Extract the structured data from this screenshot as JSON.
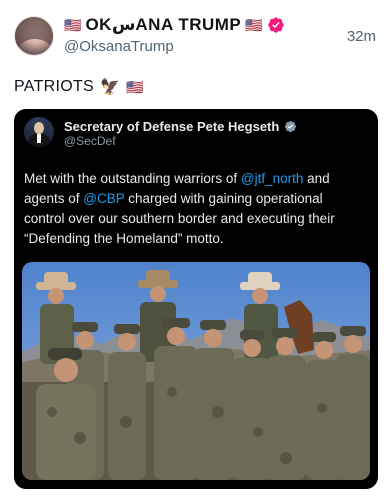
{
  "post": {
    "author": {
      "display_name": "OKسANA TRUMP",
      "flag_left": "🇺🇸",
      "flag_right": "🇺🇸",
      "handle": "@OksanaTrump",
      "verified_color": "#f91880"
    },
    "timestamp": "32m",
    "text": "PATRIOTS",
    "text_emojis": [
      "🦅",
      "🇺🇸"
    ]
  },
  "quote": {
    "author": {
      "display_name": "Secretary of Defense Pete Hegseth",
      "handle": "@SecDef",
      "verified_color": "#829aab"
    },
    "text": {
      "part1": "Met with the outstanding warriors of ",
      "mention1": "@jtf_north",
      "part2": " and agents of ",
      "mention2": "@CBP",
      "part3": " charged with gaining operational control over our southern border and executing their “Defending the Homeland” motto."
    },
    "image": {
      "icon": "group-photo-icon",
      "colors": {
        "sky": "#5f8fd2",
        "mountains": "#8d8f96",
        "uniform": "#6c6b55",
        "cap": "#4a4a3d",
        "skin": "#c59474",
        "cowboy_hat": "#cdb595"
      }
    },
    "link_color": "#1d9bf0"
  }
}
